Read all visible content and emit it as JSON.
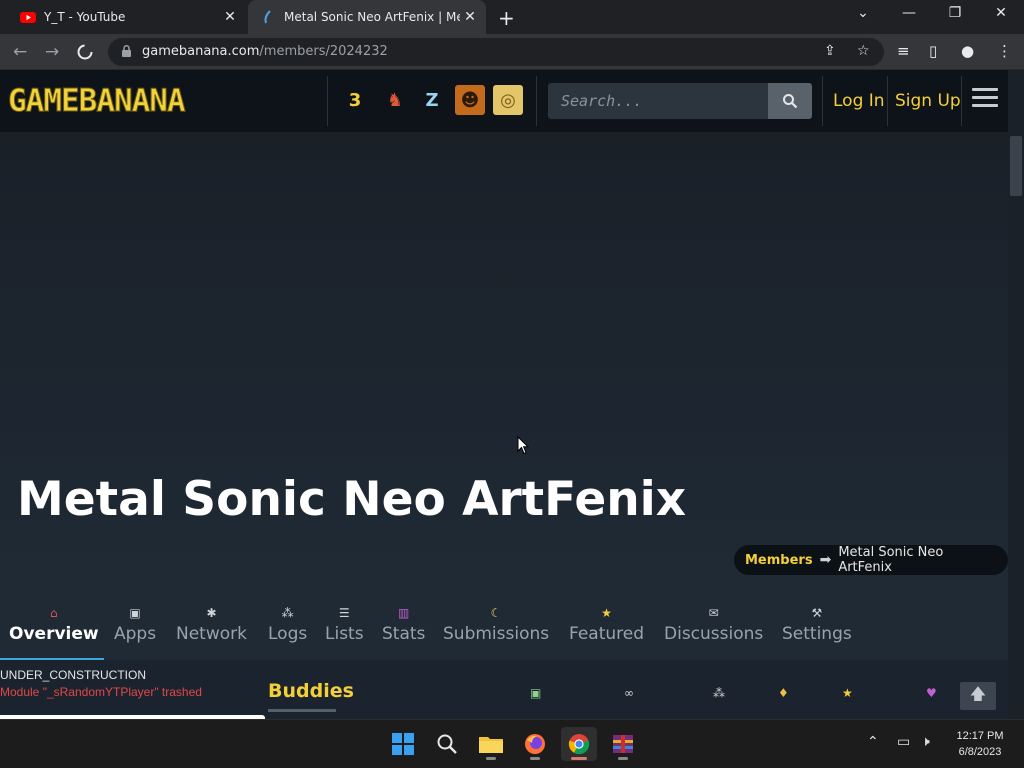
{
  "browser": {
    "tabs": [
      {
        "title": "Y_T - YouTube",
        "active": false
      },
      {
        "title": "Metal Sonic Neo ArtFenix | Members",
        "active": true
      }
    ],
    "new_tab": "+",
    "url_host": "gamebanana.com",
    "url_path": "/members/2024232",
    "controls": {
      "minimize": "—",
      "restore": "❐",
      "close": "✕",
      "tab_menu": "⌄"
    }
  },
  "site": {
    "logo": "GAMEBANANA",
    "game_icons": [
      {
        "name": "3air-icon",
        "label": "3",
        "bg": "#111",
        "color": "#f3cf3a"
      },
      {
        "name": "fighter-icon",
        "label": "♞",
        "bg": "#111",
        "color": "#e05a3a"
      },
      {
        "name": "zelda-icon",
        "label": "Z",
        "bg": "#111",
        "color": "#9ad3f0"
      },
      {
        "name": "counter-strike-icon",
        "label": "☻",
        "bg": "#c46a1c",
        "color": "#2b1a08"
      },
      {
        "name": "spiral-icon",
        "label": "◎",
        "bg": "#e3c56a",
        "color": "#7a5a18"
      }
    ],
    "search_placeholder": "Search...",
    "login": "Log In",
    "signup": "Sign Up"
  },
  "member": {
    "name": "Metal Sonic Neo ArtFenix",
    "breadcrumb": [
      "Members",
      "Metal Sonic Neo ArtFenix"
    ]
  },
  "nav_tabs": [
    {
      "label": "Overview",
      "icon": "⌂",
      "icon_name": "home-icon",
      "active": true
    },
    {
      "label": "Apps",
      "icon": "▣",
      "icon_name": "apps-icon",
      "active": false
    },
    {
      "label": "Network",
      "icon": "✱",
      "icon_name": "network-icon",
      "active": false
    },
    {
      "label": "Logs",
      "icon": "⁂",
      "icon_name": "logs-icon",
      "active": false
    },
    {
      "label": "Lists",
      "icon": "☰",
      "icon_name": "lists-icon",
      "active": false
    },
    {
      "label": "Stats",
      "icon": "▥",
      "icon_name": "stats-icon",
      "active": false
    },
    {
      "label": "Submissions",
      "icon": "☾",
      "icon_name": "submissions-icon",
      "active": false
    },
    {
      "label": "Featured",
      "icon": "★",
      "icon_name": "featured-icon",
      "active": false
    },
    {
      "label": "Discussions",
      "icon": "✉",
      "icon_name": "discussions-icon",
      "active": false
    },
    {
      "label": "Settings",
      "icon": "⚒",
      "icon_name": "settings-icon",
      "active": false
    }
  ],
  "lower": {
    "status": "UNDER_CONSTRUCTION",
    "error": "Module \"_sRandomYTPlayer\" trashed",
    "section_title": "Buddies",
    "mini_icons": [
      {
        "name": "monitor-icon",
        "glyph": "▣",
        "color": "#8fd08f"
      },
      {
        "name": "link-icon",
        "glyph": "∞",
        "color": "#d0d0d0"
      },
      {
        "name": "people-icon",
        "glyph": "⁂",
        "color": "#d0d0d0"
      },
      {
        "name": "pin-icon",
        "glyph": "♦",
        "color": "#f0c040"
      },
      {
        "name": "star-icon",
        "glyph": "★",
        "color": "#f3cf3a"
      },
      {
        "name": "heart-icon",
        "glyph": "♥",
        "color": "#c060d0"
      }
    ]
  },
  "taskbar": {
    "time": "12:17 PM",
    "date": "6/8/2023"
  }
}
